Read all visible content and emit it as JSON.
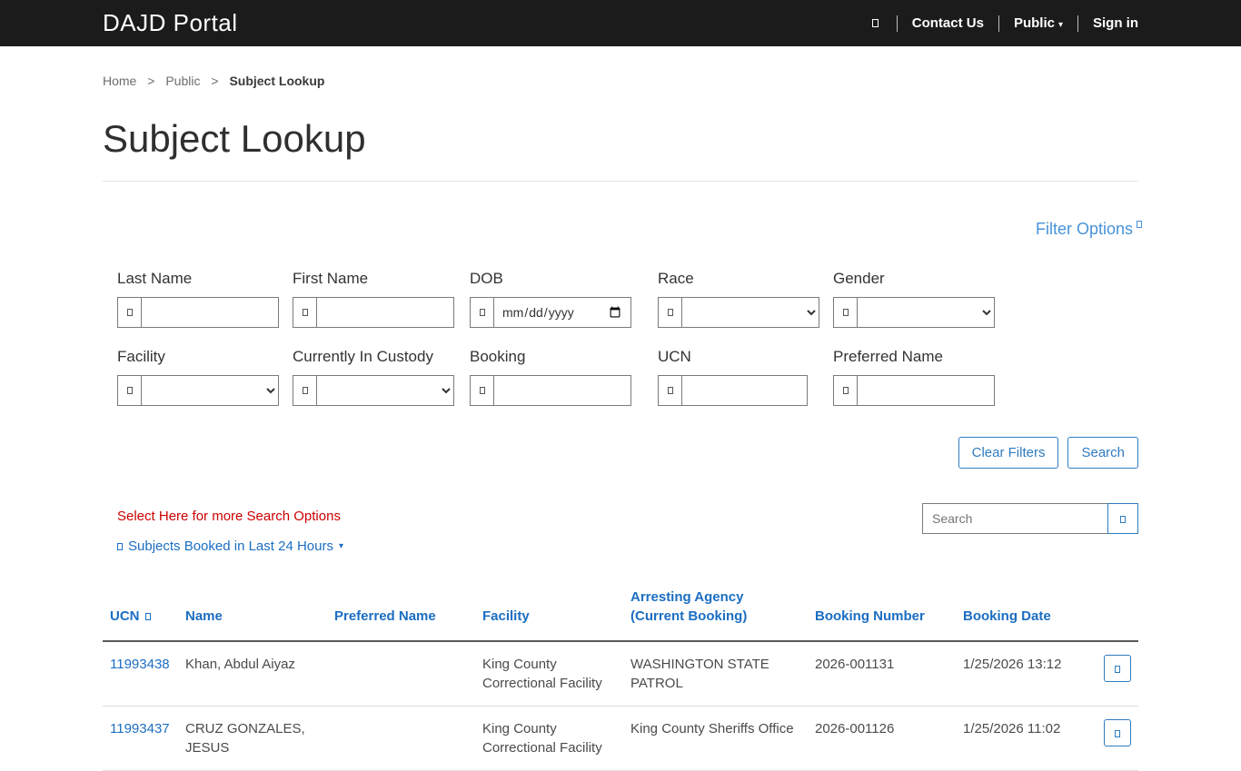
{
  "header": {
    "brand": "DAJD Portal",
    "nav": {
      "contact": "Contact Us",
      "public": "Public",
      "signin": "Sign in"
    }
  },
  "breadcrumb": {
    "home": "Home",
    "public": "Public",
    "current": "Subject Lookup"
  },
  "page": {
    "title": "Subject Lookup"
  },
  "filters": {
    "options_label": "Filter Options",
    "labels": {
      "last_name": "Last Name",
      "first_name": "First Name",
      "dob": "DOB",
      "race": "Race",
      "gender": "Gender",
      "facility": "Facility",
      "in_custody": "Currently In Custody",
      "booking": "Booking",
      "ucn": "UCN",
      "preferred_name": "Preferred Name"
    },
    "dob_placeholder": "mm/dd/yyyy",
    "clear_button": "Clear Filters",
    "search_button": "Search"
  },
  "search_section": {
    "more_options": "Select Here for more Search Options",
    "booked_link": "Subjects Booked in Last 24 Hours",
    "table_search_placeholder": "Search"
  },
  "table": {
    "headers": {
      "ucn": "UCN",
      "name": "Name",
      "preferred_name": "Preferred Name",
      "facility": "Facility",
      "agency": "Arresting Agency (Current Booking)",
      "booking_number": "Booking Number",
      "booking_date": "Booking Date"
    },
    "rows": [
      {
        "ucn": "11993438",
        "name": "Khan, Abdul Aiyaz",
        "preferred_name": "",
        "facility": "King County Correctional Facility",
        "agency": "WASHINGTON STATE PATROL",
        "booking_number": "2026-001131",
        "booking_date": "1/25/2026 13:12"
      },
      {
        "ucn": "11993437",
        "name": "CRUZ GONZALES, JESUS",
        "preferred_name": "",
        "facility": "King County Correctional Facility",
        "agency": "King County Sheriffs Office",
        "booking_number": "2026-001126",
        "booking_date": "1/25/2026 11:02"
      }
    ]
  },
  "colors": {
    "header_bg": "#1b1b1b",
    "link_blue": "#1b6ec2",
    "danger_red": "#cc0000"
  }
}
